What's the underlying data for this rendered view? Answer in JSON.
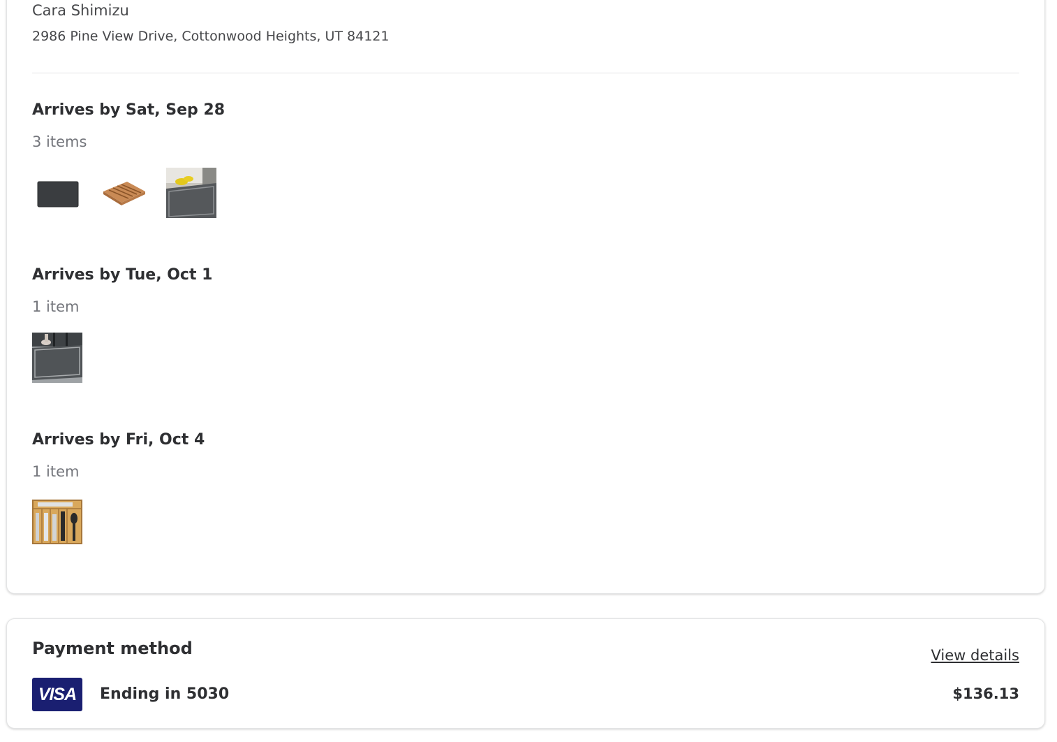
{
  "shipping": {
    "recipient_name": "Cara Shimizu",
    "address": "2986 Pine View Drive, Cottonwood Heights, UT 84121",
    "groups": [
      {
        "title": "Arrives by Sat, Sep 28",
        "count": "3 items",
        "items": [
          "black-mat-thumbnail",
          "bamboo-tray-thumbnail",
          "runner-rug-thumbnail"
        ]
      },
      {
        "title": "Arrives by Tue, Oct 1",
        "count": "1 item",
        "items": [
          "doormat-photo-thumbnail"
        ]
      },
      {
        "title": "Arrives by Fri, Oct 4",
        "count": "1 item",
        "items": [
          "utensil-organizer-thumbnail"
        ]
      }
    ]
  },
  "payment": {
    "title": "Payment method",
    "view_details_label": "View details",
    "card_brand": "VISA",
    "card_brand_color": "#1a1f71",
    "card_ending": "Ending in 5030",
    "amount": "$136.13"
  }
}
